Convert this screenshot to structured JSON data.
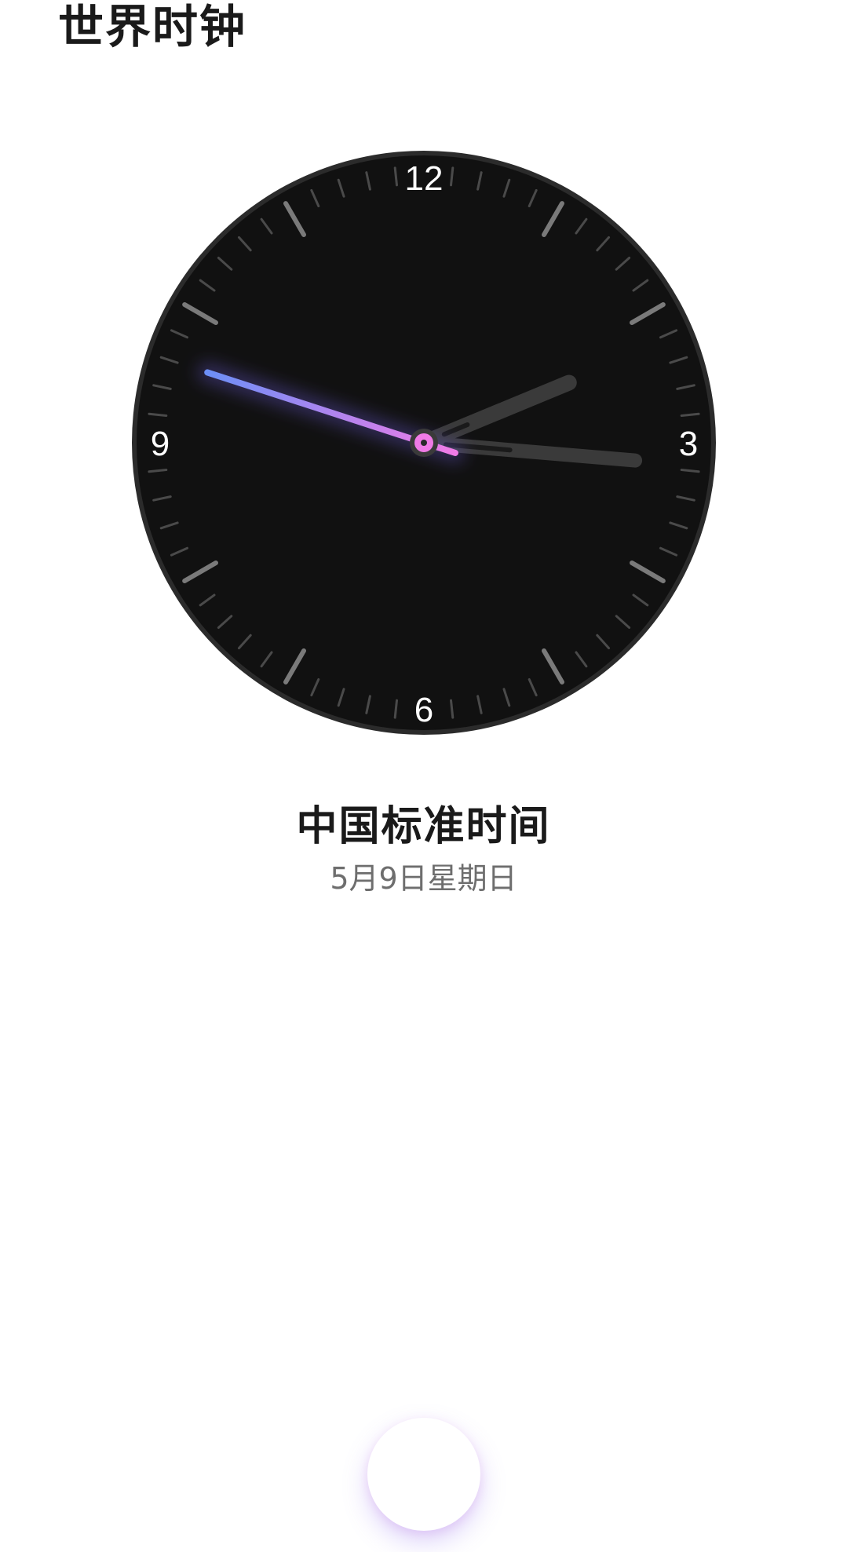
{
  "header": {
    "title": "世界时钟"
  },
  "clock": {
    "numerals": {
      "twelve": "12",
      "three": "3",
      "six": "6",
      "nine": "9"
    },
    "time": {
      "hour": 2,
      "minute": 15,
      "second": 48
    },
    "colors": {
      "face": "#111111",
      "rim": "#2b2b2b",
      "hands": "#3a3a3a",
      "second_hand_start": "#6c8ff7",
      "second_hand_end": "#f07be6"
    }
  },
  "zone": {
    "name": "中国标准时间",
    "date": "5月9日星期日"
  },
  "add_button": {
    "icon": "plus-icon",
    "gradient_start": "#5f79f5",
    "gradient_end": "#c04fd8"
  }
}
